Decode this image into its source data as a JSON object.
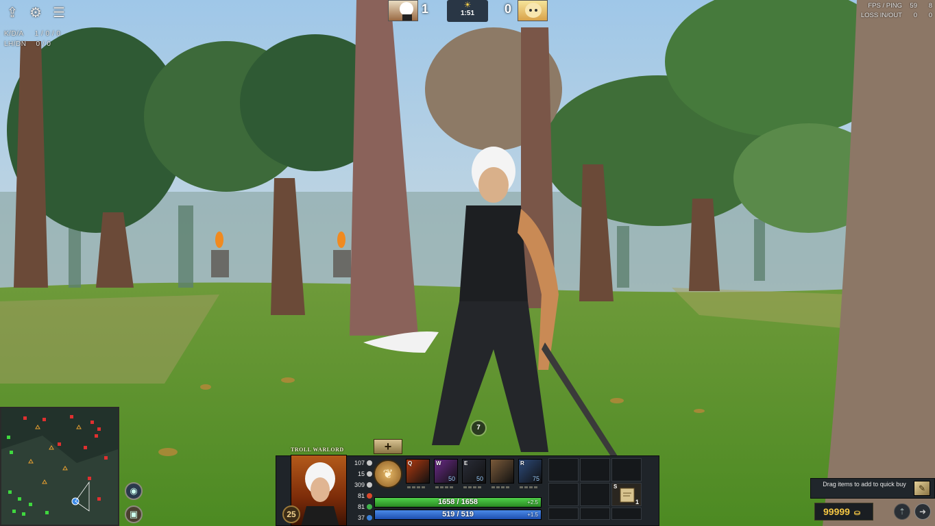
{
  "top_left": {
    "icons": [
      "upload-icon",
      "gear-icon",
      "menu-icon"
    ],
    "kda_label": "K/D/A",
    "kda_value": "1 / 0 / 0",
    "lhdn_label": "LH/DN",
    "lhdn_value": "0 / 0"
  },
  "scoreboard": {
    "left_score": "1",
    "right_score": "0",
    "clock": "1:51",
    "clock_icon": "sun-icon"
  },
  "top_right": {
    "fps_ping_label": "FPS / PING",
    "fps": "59",
    "ping": "8",
    "loss_label": "LOSS IN/OUT",
    "loss_in": "0",
    "loss_out": "0"
  },
  "hero": {
    "name": "TROLL WARLORD",
    "level": "25",
    "stats": [
      {
        "value": "107",
        "icon": "sword-icon",
        "color": "#c8c8c8"
      },
      {
        "value": "15",
        "icon": "shield-icon",
        "color": "#c8c8c8"
      },
      {
        "value": "309",
        "icon": "boot-icon",
        "color": "#c8c8c8"
      },
      {
        "value": "81",
        "icon": "strength-icon",
        "color": "#d9482b"
      },
      {
        "value": "81",
        "icon": "agility-icon",
        "color": "#3fb34a"
      },
      {
        "value": "37",
        "icon": "intelligence-icon",
        "color": "#3a7fd6"
      }
    ]
  },
  "talent": {
    "button_label": "+"
  },
  "abilities": [
    {
      "key": "Q",
      "cost": "",
      "color": "#b33a10",
      "name": "ability-q"
    },
    {
      "key": "W",
      "cost": "50",
      "color": "#6a2a88",
      "name": "ability-w"
    },
    {
      "key": "E",
      "cost": "50",
      "color": "#2a2d38",
      "name": "ability-e"
    },
    {
      "key": "",
      "cost": "",
      "color": "#7a5a3a",
      "name": "ability-4"
    },
    {
      "key": "R",
      "cost": "75",
      "color": "#2c4a7a",
      "name": "ability-r"
    }
  ],
  "bars": {
    "health": "1658 / 1658",
    "health_regen": "+2.5",
    "health_fill": 1.0,
    "mana": "519 / 519",
    "mana_regen": "+1.5",
    "mana_fill": 1.0
  },
  "inventory": {
    "scroll_key": "S",
    "scroll_count": "1"
  },
  "quickbuy": {
    "text": "Drag items to add to quick buy"
  },
  "gold": {
    "amount": "99999"
  }
}
